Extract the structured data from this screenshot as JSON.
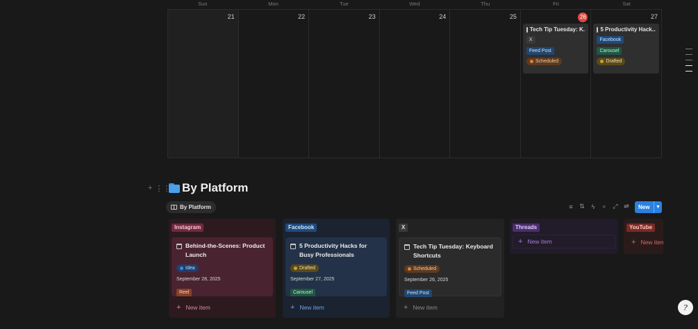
{
  "calendar": {
    "weekdays": [
      "Sun",
      "Mon",
      "Tue",
      "Wed",
      "Thu",
      "Fri",
      "Sat"
    ],
    "days": [
      "21",
      "22",
      "23",
      "24",
      "25",
      "26",
      "27"
    ],
    "today": "26",
    "events": [
      {
        "day": "26",
        "title": "Tech Tip Tuesday: K...",
        "platform": "X",
        "format": "Feed Post",
        "status": "Scheduled"
      },
      {
        "day": "27",
        "title": "5 Productivity Hack...",
        "platform": "Facebook",
        "format": "Carousel",
        "status": "Drafted"
      }
    ]
  },
  "section": {
    "title": "By Platform",
    "icon": "folder-icon",
    "view_tab": "By Platform",
    "new_button": "New"
  },
  "board": {
    "columns": [
      {
        "name": "Instagram",
        "color": "#6e2a3e",
        "card": {
          "title": "Behind-the-Scenes: Product Launch",
          "status": "Idea",
          "date": "September 28, 2025",
          "format": "Reel"
        },
        "new_item": "New item"
      },
      {
        "name": "Facebook",
        "color": "#1f4a7a",
        "card": {
          "title": "5 Productivity Hacks for Busy Professionals",
          "status": "Drafted",
          "date": "September 27, 2025",
          "format": "Carousel"
        },
        "new_item": "New item"
      },
      {
        "name": "X",
        "color": "#3a3a3a",
        "card": {
          "title": "Tech Tip Tuesday: Keyboard Shortcuts",
          "status": "Scheduled",
          "date": "September 26, 2025",
          "format": "Feed Post"
        },
        "new_item": "New item"
      },
      {
        "name": "Threads",
        "color": "#4a2e6a",
        "new_item": "New item"
      },
      {
        "name": "YouTube",
        "color": "#7a2a25",
        "new_item": "New item"
      }
    ]
  },
  "help_label": "?"
}
